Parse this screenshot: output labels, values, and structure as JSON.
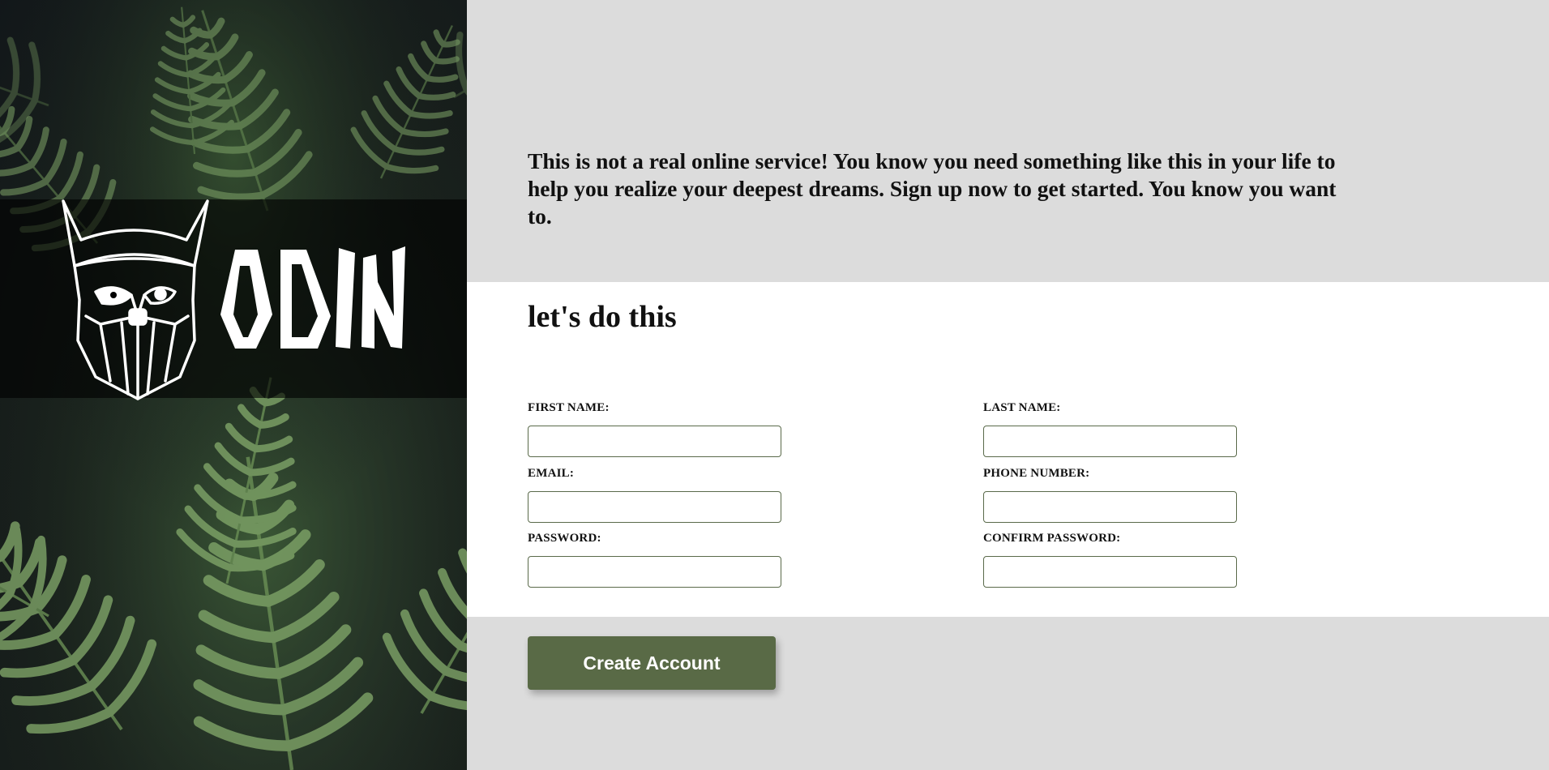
{
  "brand": {
    "name": "ODIN",
    "logo_icon": "viking-head-icon",
    "background_image": "fern-leaves-photo"
  },
  "intro": {
    "text": "This is not a real online service! You know you need something like this in your life to help you realize your deepest dreams. Sign up now to get started. You know you want to."
  },
  "form": {
    "heading": "let's do this",
    "fields": {
      "first_name": {
        "label": "FIRST NAME:",
        "value": "",
        "placeholder": ""
      },
      "last_name": {
        "label": "LAST NAME:",
        "value": "",
        "placeholder": ""
      },
      "email": {
        "label": "EMAIL:",
        "value": "",
        "placeholder": ""
      },
      "phone": {
        "label": "PHONE NUMBER:",
        "value": "",
        "placeholder": ""
      },
      "password": {
        "label": "PASSWORD:",
        "value": "",
        "placeholder": ""
      },
      "confirm_password": {
        "label": "CONFIRM PASSWORD:",
        "value": "",
        "placeholder": ""
      }
    },
    "submit_label": "Create Account"
  },
  "colors": {
    "accent": "#596a46",
    "input_border": "#5a6a4a",
    "page_background": "#dcdcdc",
    "panel_background": "#ffffff"
  }
}
